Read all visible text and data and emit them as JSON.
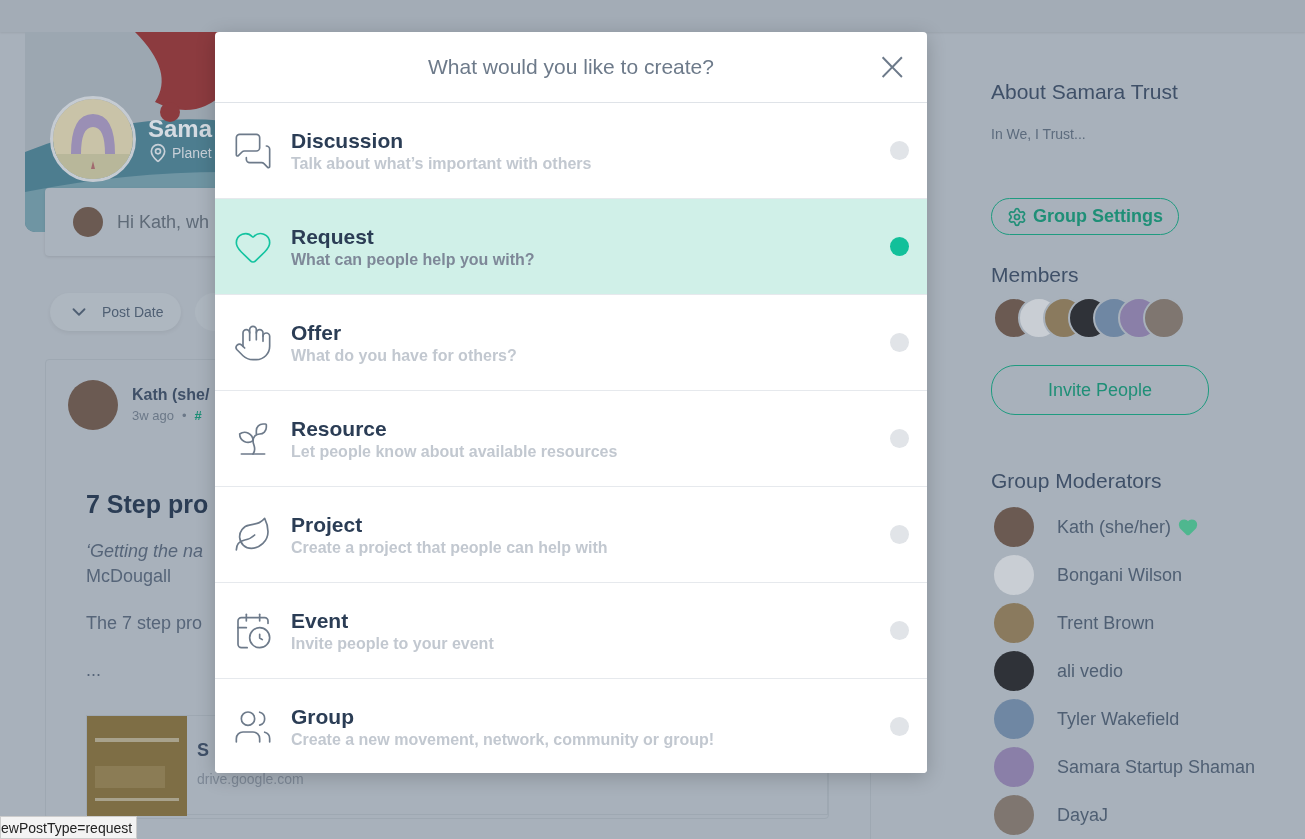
{
  "group_header": {
    "name": "Sama",
    "location": "Planet"
  },
  "post_box": {
    "placeholder": "Hi Kath, wh"
  },
  "filters": [
    {
      "label": "Post Date"
    }
  ],
  "post": {
    "author": "Kath (she/",
    "time": "3w ago",
    "separator": "•",
    "topic": "#",
    "title": "7 Step pro",
    "quote": "‘Getting the na",
    "quote_end": "McDougall",
    "body": "The 7 step pro",
    "more": "...",
    "link": {
      "title": "S",
      "domain": "drive.google.com"
    }
  },
  "sidebar": {
    "about_title": "About Samara Trust",
    "about_text": "In We, I Trust...",
    "settings_button": "Group Settings",
    "members_title": "Members",
    "invite_button": "Invite People",
    "moderators_title": "Group Moderators",
    "moderators": [
      {
        "name": "Kath (she/her)",
        "hearted": true,
        "color": "#6b5a52"
      },
      {
        "name": "Bongani Wilson",
        "hearted": false,
        "color": "#c9ced4"
      },
      {
        "name": "Trent Brown",
        "hearted": false,
        "color": "#8a7a5e"
      },
      {
        "name": "ali vedio",
        "hearted": false,
        "color": "#2f3238"
      },
      {
        "name": "Tyler Wakefield",
        "hearted": false,
        "color": "#6f87a3"
      },
      {
        "name": "Samara Startup Shaman",
        "hearted": false,
        "color": "#8a7fa8"
      },
      {
        "name": "DayaJ",
        "hearted": false,
        "color": "#7f7670"
      }
    ]
  },
  "modal": {
    "title": "What would you like to create?",
    "close": "×",
    "options": [
      {
        "title": "Discussion",
        "description": "Talk about what’s important with others",
        "selected": false
      },
      {
        "title": "Request",
        "description": "What can people help you with?",
        "selected": true
      },
      {
        "title": "Offer",
        "description": "What do you have for others?",
        "selected": false
      },
      {
        "title": "Resource",
        "description": "Let people know about available resources",
        "selected": false
      },
      {
        "title": "Project",
        "description": "Create a project that people can help with",
        "selected": false
      },
      {
        "title": "Event",
        "description": "Invite people to your event",
        "selected": false
      },
      {
        "title": "Group",
        "description": "Create a new movement, network, community or group!",
        "selected": false
      }
    ]
  },
  "status_bar": {
    "url": "ewPostType=request"
  }
}
